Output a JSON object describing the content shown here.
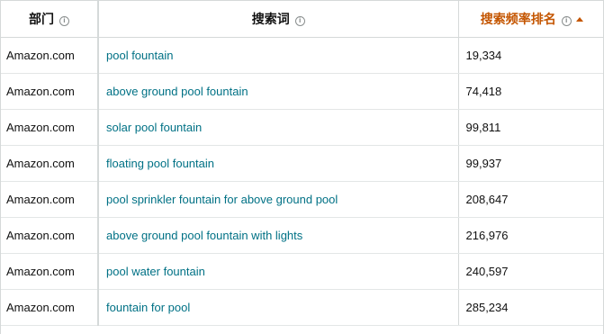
{
  "table": {
    "headers": {
      "department": "部门",
      "search_term": "搜索词",
      "search_frequency_rank": "搜索频率排名"
    },
    "icons": {
      "info": "info-circle-icon",
      "sort": "sort-ascending-icon"
    },
    "colors": {
      "link": "#007185",
      "sorted_header": "#c45500"
    },
    "rows": [
      {
        "department": "Amazon.com",
        "search_term": "pool fountain",
        "rank": "19,334"
      },
      {
        "department": "Amazon.com",
        "search_term": "above ground pool fountain",
        "rank": "74,418"
      },
      {
        "department": "Amazon.com",
        "search_term": "solar pool fountain",
        "rank": "99,811"
      },
      {
        "department": "Amazon.com",
        "search_term": "floating pool fountain",
        "rank": "99,937"
      },
      {
        "department": "Amazon.com",
        "search_term": "pool sprinkler fountain for above ground pool",
        "rank": "208,647"
      },
      {
        "department": "Amazon.com",
        "search_term": "above ground pool fountain with lights",
        "rank": "216,976"
      },
      {
        "department": "Amazon.com",
        "search_term": "pool water fountain",
        "rank": "240,597"
      },
      {
        "department": "Amazon.com",
        "search_term": "fountain for pool",
        "rank": "285,234"
      }
    ]
  }
}
